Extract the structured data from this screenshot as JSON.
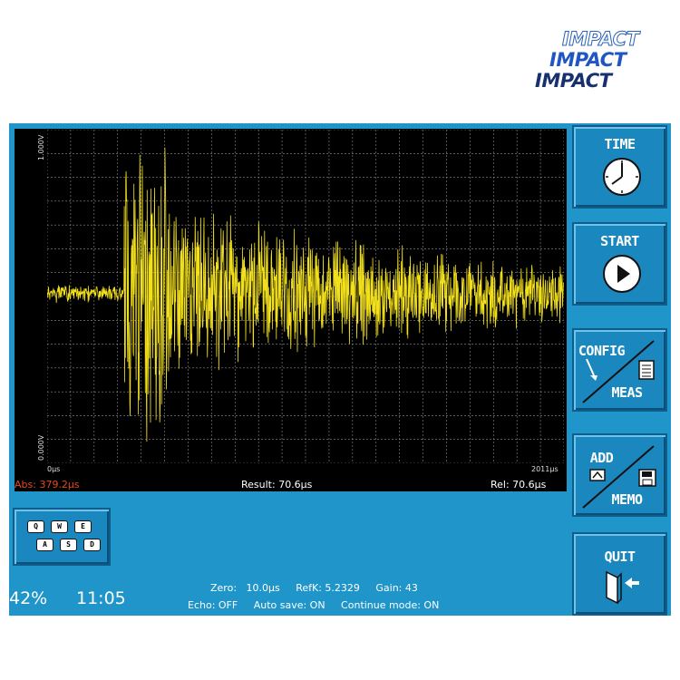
{
  "logo": {
    "lines": [
      "IMPACT",
      "IMPACT",
      "IMPACT"
    ]
  },
  "scope": {
    "y_top_label": "1.000V",
    "y_bottom_label": "0.000V",
    "x_left_label": "0µs",
    "x_right_label": "2011µs",
    "trace_color": "#f2e01c",
    "grid_color": "#8c8c8c"
  },
  "readouts": {
    "abs": "Abs: 379.2µs",
    "result": "Result:   70.6µs",
    "rel": "Rel:   70.6µs",
    "abs_color": "#e24a1c"
  },
  "buttons": {
    "time": "TIME",
    "start": "START",
    "config": "CONFIG",
    "meas": "MEAS",
    "add": "ADD",
    "memo": "MEMO",
    "quit": "QUIT"
  },
  "keyboard": {
    "keys": [
      "Q",
      "W",
      "E",
      "A",
      "S",
      "D"
    ]
  },
  "status": {
    "battery": "42%",
    "time": "11:05",
    "line1": "Zero:   10.0µs     RefK: 5.2329     Gain: 43",
    "line2": "Echo: OFF     Auto save: ON     Continue mode: ON"
  },
  "colors": {
    "panel": "#1f95c9",
    "button": "#1b87bf",
    "button_border": "#0d5e8d"
  }
}
